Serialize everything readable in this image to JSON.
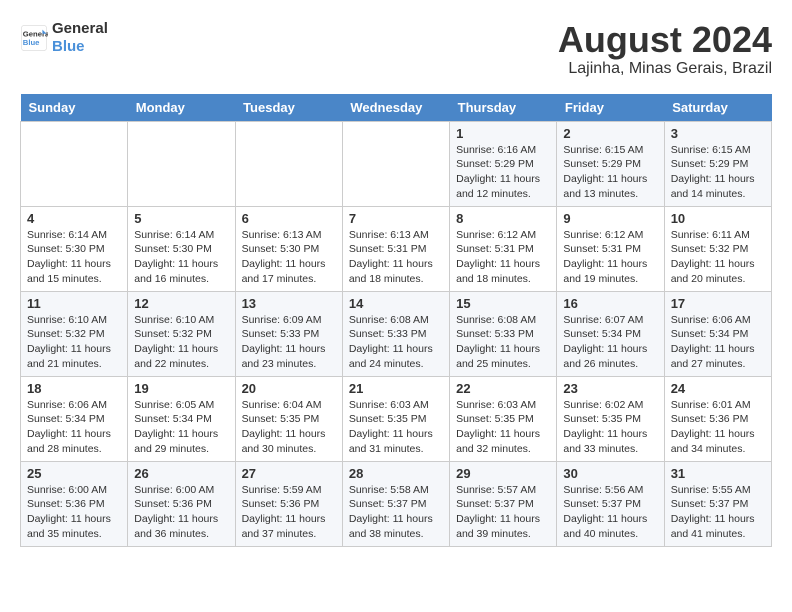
{
  "logo": {
    "line1": "General",
    "line2": "Blue"
  },
  "title": "August 2024",
  "location": "Lajinha, Minas Gerais, Brazil",
  "days_of_week": [
    "Sunday",
    "Monday",
    "Tuesday",
    "Wednesday",
    "Thursday",
    "Friday",
    "Saturday"
  ],
  "weeks": [
    [
      {
        "day": "",
        "info": ""
      },
      {
        "day": "",
        "info": ""
      },
      {
        "day": "",
        "info": ""
      },
      {
        "day": "",
        "info": ""
      },
      {
        "day": "1",
        "info": "Sunrise: 6:16 AM\nSunset: 5:29 PM\nDaylight: 11 hours\nand 12 minutes."
      },
      {
        "day": "2",
        "info": "Sunrise: 6:15 AM\nSunset: 5:29 PM\nDaylight: 11 hours\nand 13 minutes."
      },
      {
        "day": "3",
        "info": "Sunrise: 6:15 AM\nSunset: 5:29 PM\nDaylight: 11 hours\nand 14 minutes."
      }
    ],
    [
      {
        "day": "4",
        "info": "Sunrise: 6:14 AM\nSunset: 5:30 PM\nDaylight: 11 hours\nand 15 minutes."
      },
      {
        "day": "5",
        "info": "Sunrise: 6:14 AM\nSunset: 5:30 PM\nDaylight: 11 hours\nand 16 minutes."
      },
      {
        "day": "6",
        "info": "Sunrise: 6:13 AM\nSunset: 5:30 PM\nDaylight: 11 hours\nand 17 minutes."
      },
      {
        "day": "7",
        "info": "Sunrise: 6:13 AM\nSunset: 5:31 PM\nDaylight: 11 hours\nand 18 minutes."
      },
      {
        "day": "8",
        "info": "Sunrise: 6:12 AM\nSunset: 5:31 PM\nDaylight: 11 hours\nand 18 minutes."
      },
      {
        "day": "9",
        "info": "Sunrise: 6:12 AM\nSunset: 5:31 PM\nDaylight: 11 hours\nand 19 minutes."
      },
      {
        "day": "10",
        "info": "Sunrise: 6:11 AM\nSunset: 5:32 PM\nDaylight: 11 hours\nand 20 minutes."
      }
    ],
    [
      {
        "day": "11",
        "info": "Sunrise: 6:10 AM\nSunset: 5:32 PM\nDaylight: 11 hours\nand 21 minutes."
      },
      {
        "day": "12",
        "info": "Sunrise: 6:10 AM\nSunset: 5:32 PM\nDaylight: 11 hours\nand 22 minutes."
      },
      {
        "day": "13",
        "info": "Sunrise: 6:09 AM\nSunset: 5:33 PM\nDaylight: 11 hours\nand 23 minutes."
      },
      {
        "day": "14",
        "info": "Sunrise: 6:08 AM\nSunset: 5:33 PM\nDaylight: 11 hours\nand 24 minutes."
      },
      {
        "day": "15",
        "info": "Sunrise: 6:08 AM\nSunset: 5:33 PM\nDaylight: 11 hours\nand 25 minutes."
      },
      {
        "day": "16",
        "info": "Sunrise: 6:07 AM\nSunset: 5:34 PM\nDaylight: 11 hours\nand 26 minutes."
      },
      {
        "day": "17",
        "info": "Sunrise: 6:06 AM\nSunset: 5:34 PM\nDaylight: 11 hours\nand 27 minutes."
      }
    ],
    [
      {
        "day": "18",
        "info": "Sunrise: 6:06 AM\nSunset: 5:34 PM\nDaylight: 11 hours\nand 28 minutes."
      },
      {
        "day": "19",
        "info": "Sunrise: 6:05 AM\nSunset: 5:34 PM\nDaylight: 11 hours\nand 29 minutes."
      },
      {
        "day": "20",
        "info": "Sunrise: 6:04 AM\nSunset: 5:35 PM\nDaylight: 11 hours\nand 30 minutes."
      },
      {
        "day": "21",
        "info": "Sunrise: 6:03 AM\nSunset: 5:35 PM\nDaylight: 11 hours\nand 31 minutes."
      },
      {
        "day": "22",
        "info": "Sunrise: 6:03 AM\nSunset: 5:35 PM\nDaylight: 11 hours\nand 32 minutes."
      },
      {
        "day": "23",
        "info": "Sunrise: 6:02 AM\nSunset: 5:35 PM\nDaylight: 11 hours\nand 33 minutes."
      },
      {
        "day": "24",
        "info": "Sunrise: 6:01 AM\nSunset: 5:36 PM\nDaylight: 11 hours\nand 34 minutes."
      }
    ],
    [
      {
        "day": "25",
        "info": "Sunrise: 6:00 AM\nSunset: 5:36 PM\nDaylight: 11 hours\nand 35 minutes."
      },
      {
        "day": "26",
        "info": "Sunrise: 6:00 AM\nSunset: 5:36 PM\nDaylight: 11 hours\nand 36 minutes."
      },
      {
        "day": "27",
        "info": "Sunrise: 5:59 AM\nSunset: 5:36 PM\nDaylight: 11 hours\nand 37 minutes."
      },
      {
        "day": "28",
        "info": "Sunrise: 5:58 AM\nSunset: 5:37 PM\nDaylight: 11 hours\nand 38 minutes."
      },
      {
        "day": "29",
        "info": "Sunrise: 5:57 AM\nSunset: 5:37 PM\nDaylight: 11 hours\nand 39 minutes."
      },
      {
        "day": "30",
        "info": "Sunrise: 5:56 AM\nSunset: 5:37 PM\nDaylight: 11 hours\nand 40 minutes."
      },
      {
        "day": "31",
        "info": "Sunrise: 5:55 AM\nSunset: 5:37 PM\nDaylight: 11 hours\nand 41 minutes."
      }
    ]
  ]
}
